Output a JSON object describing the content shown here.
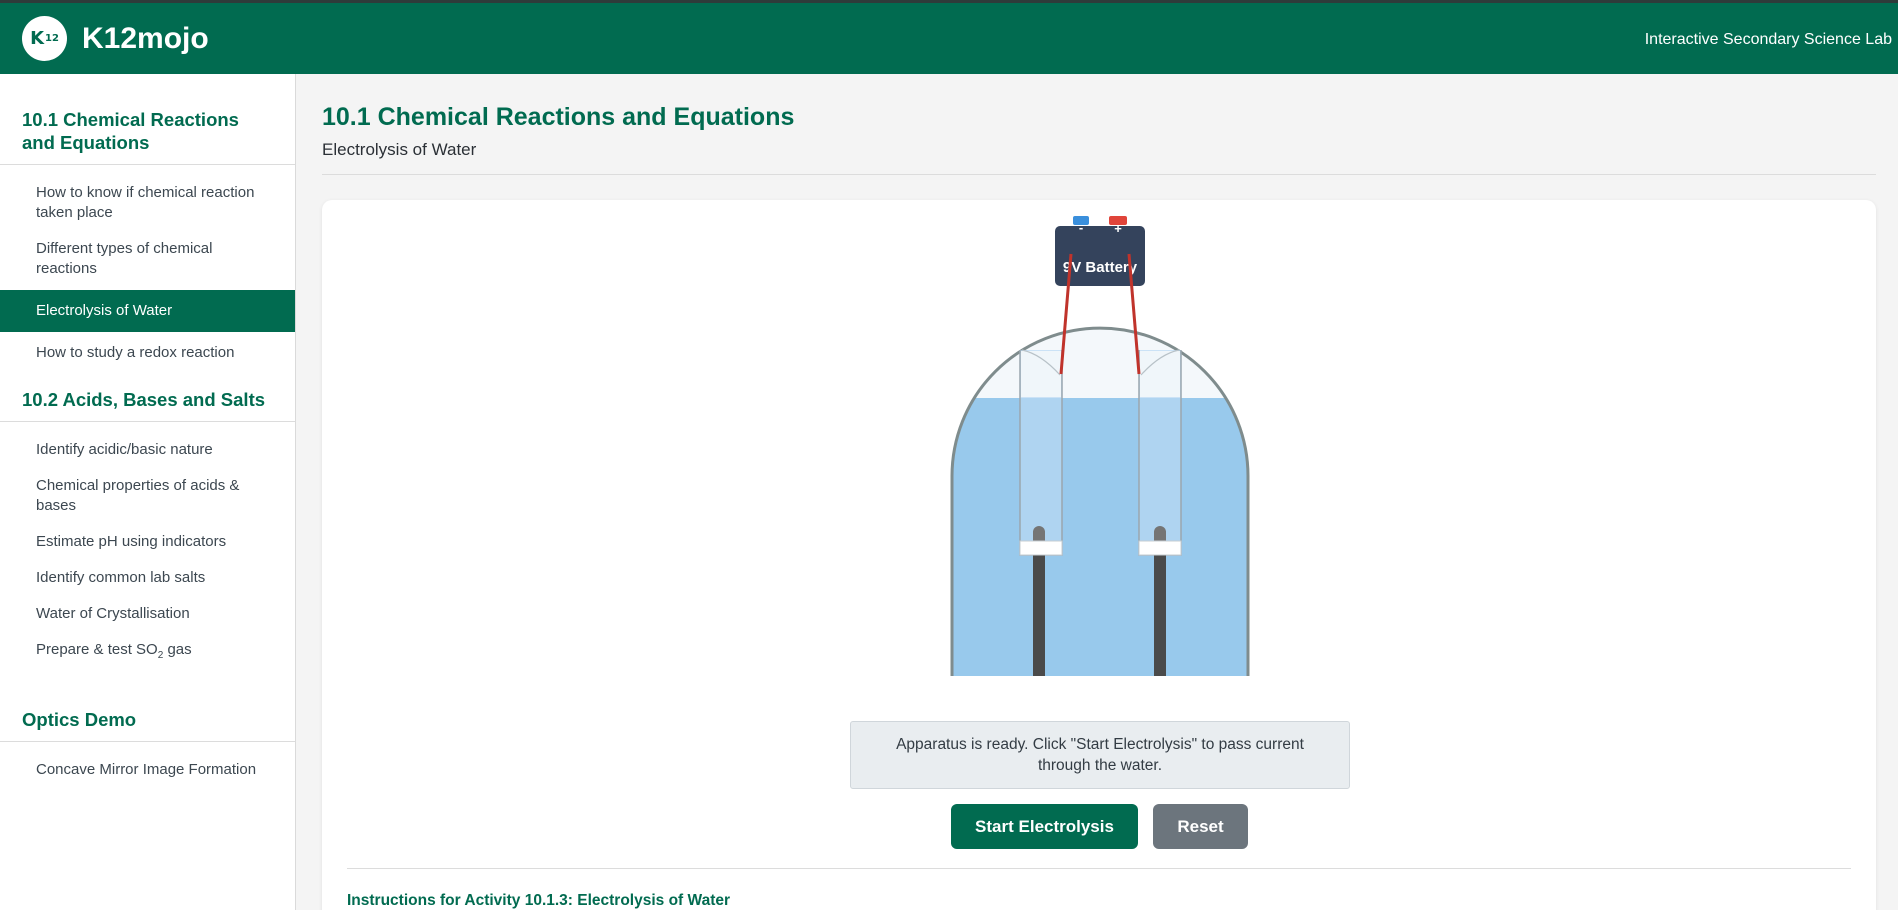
{
  "header": {
    "logo_text": "K",
    "logo_sup": "12",
    "brand": "K12mojo",
    "tagline": "Interactive Secondary Science Lab"
  },
  "sidebar": {
    "sections": [
      {
        "title": "10.1 Chemical Reactions and Equations",
        "items": [
          {
            "label": "How to know if chemical reaction taken place"
          },
          {
            "label": "Different types of chemical reactions"
          },
          {
            "label": "Electrolysis of Water",
            "active": true
          },
          {
            "label": "How to study a redox reaction"
          }
        ]
      },
      {
        "title": "10.2 Acids, Bases and Salts",
        "items": [
          {
            "label": "Identify acidic/basic nature"
          },
          {
            "label": "Chemical properties of acids & bases"
          },
          {
            "label": "Estimate pH using indicators"
          },
          {
            "label": "Identify common lab salts"
          },
          {
            "label": "Water of Crystallisation"
          },
          {
            "label_prefix": "Prepare & test SO",
            "label_sub": "2",
            "label_suffix": " gas"
          }
        ]
      },
      {
        "title": "Optics Demo",
        "items": [
          {
            "label": "Concave Mirror Image Formation"
          }
        ]
      }
    ]
  },
  "main": {
    "title": "10.1 Chemical Reactions and Equations",
    "subtitle": "Electrolysis of Water"
  },
  "apparatus": {
    "battery_label": "9V Battery",
    "negative_sign": "-",
    "positive_sign": "+",
    "colors": {
      "battery": "#34435c",
      "terminal_negative": "#3a8fdc",
      "terminal_positive": "#e0443a",
      "wire": "#c0332b",
      "water": "#98c9ec",
      "glass_outline": "#7f8c8d",
      "electrode": "#4a4a4a"
    }
  },
  "status": {
    "message": "Apparatus is ready. Click \"Start Electrolysis\" to pass current through the water."
  },
  "controls": {
    "start_label": "Start Electrolysis",
    "reset_label": "Reset"
  },
  "instructions": {
    "title": "Instructions for Activity 10.1.3: Electrolysis of Water"
  }
}
